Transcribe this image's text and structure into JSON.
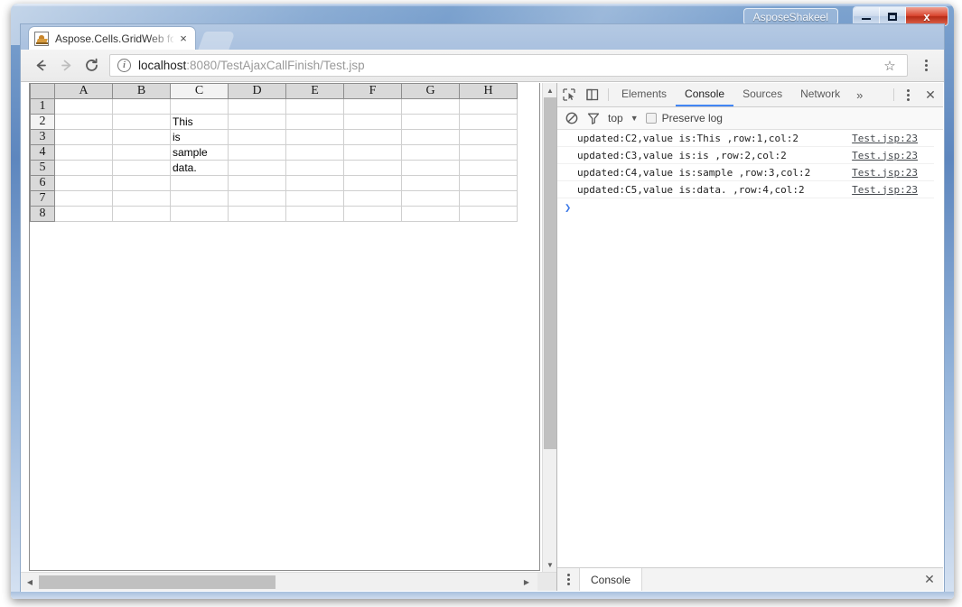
{
  "window": {
    "title": "AsposeShakeel",
    "controls": {
      "minimize": "minimize-button",
      "maximize": "maximize-button",
      "close_label": "x"
    }
  },
  "browser": {
    "tab": {
      "title": "Aspose.Cells.GridWeb fo",
      "close_label": "×",
      "favicon": "aspose-favicon"
    },
    "new_tab_label": "",
    "toolbar": {
      "back_label": "←",
      "forward_label": "→",
      "reload_label": "⟳",
      "info_label": "i",
      "url_host": "localhost",
      "url_path": ":8080/TestAjaxCallFinish/Test.jsp",
      "url_full": "localhost:8080/TestAjaxCallFinish/Test.jsp",
      "bookmark_label": "☆",
      "menu_label": "⋮"
    }
  },
  "spreadsheet": {
    "columns": [
      "A",
      "B",
      "C",
      "D",
      "E",
      "F",
      "G",
      "H"
    ],
    "selected_column": "C",
    "rows": [
      "1",
      "2",
      "3",
      "4",
      "5",
      "6",
      "7",
      "8"
    ],
    "selected_row": "2",
    "corner_label": "",
    "cells": [
      [
        "",
        "",
        "",
        "",
        "",
        "",
        "",
        ""
      ],
      [
        "",
        "",
        "This",
        "",
        "",
        "",
        "",
        ""
      ],
      [
        "",
        "",
        "is",
        "",
        "",
        "",
        "",
        ""
      ],
      [
        "",
        "",
        "sample",
        "",
        "",
        "",
        "",
        ""
      ],
      [
        "",
        "",
        "data.",
        "",
        "",
        "",
        "",
        ""
      ],
      [
        "",
        "",
        "",
        "",
        "",
        "",
        "",
        ""
      ],
      [
        "",
        "",
        "",
        "",
        "",
        "",
        "",
        ""
      ],
      [
        "",
        "",
        "",
        "",
        "",
        "",
        "",
        ""
      ]
    ],
    "scroll_arrows": {
      "up": "▲",
      "down": "▼",
      "left": "◀",
      "right": "▶"
    }
  },
  "devtools": {
    "tabs": [
      {
        "label": "Elements",
        "active": false
      },
      {
        "label": "Console",
        "active": true
      },
      {
        "label": "Sources",
        "active": false
      },
      {
        "label": "Network",
        "active": false
      }
    ],
    "more_label": "»",
    "inspect_icon": "inspect-element-icon",
    "device_icon": "device-toolbar-icon",
    "kebab_label": "⋮",
    "close_label": "✕",
    "filterbar": {
      "clear_icon": "clear-console-icon",
      "filter_icon": "filter-icon",
      "context": "top",
      "context_caret": "▼",
      "preserve_log_label": "Preserve log",
      "preserve_log_checked": false
    },
    "console_logs": [
      {
        "message": "updated:C2,value is:This ,row:1,col:2",
        "source": "Test.jsp:23"
      },
      {
        "message": "updated:C3,value is:is ,row:2,col:2",
        "source": "Test.jsp:23"
      },
      {
        "message": "updated:C4,value is:sample ,row:3,col:2",
        "source": "Test.jsp:23"
      },
      {
        "message": "updated:C5,value is:data. ,row:4,col:2",
        "source": "Test.jsp:23"
      }
    ],
    "prompt_symbol": "❯",
    "drawer": {
      "kebab_label": "⋮",
      "tab_label": "Console",
      "close_label": "✕"
    }
  },
  "colors": {
    "accent": "#4285f4",
    "frame": "#5d86be",
    "close_button": "#d9452e",
    "header_gray": "#d9d9d9"
  }
}
